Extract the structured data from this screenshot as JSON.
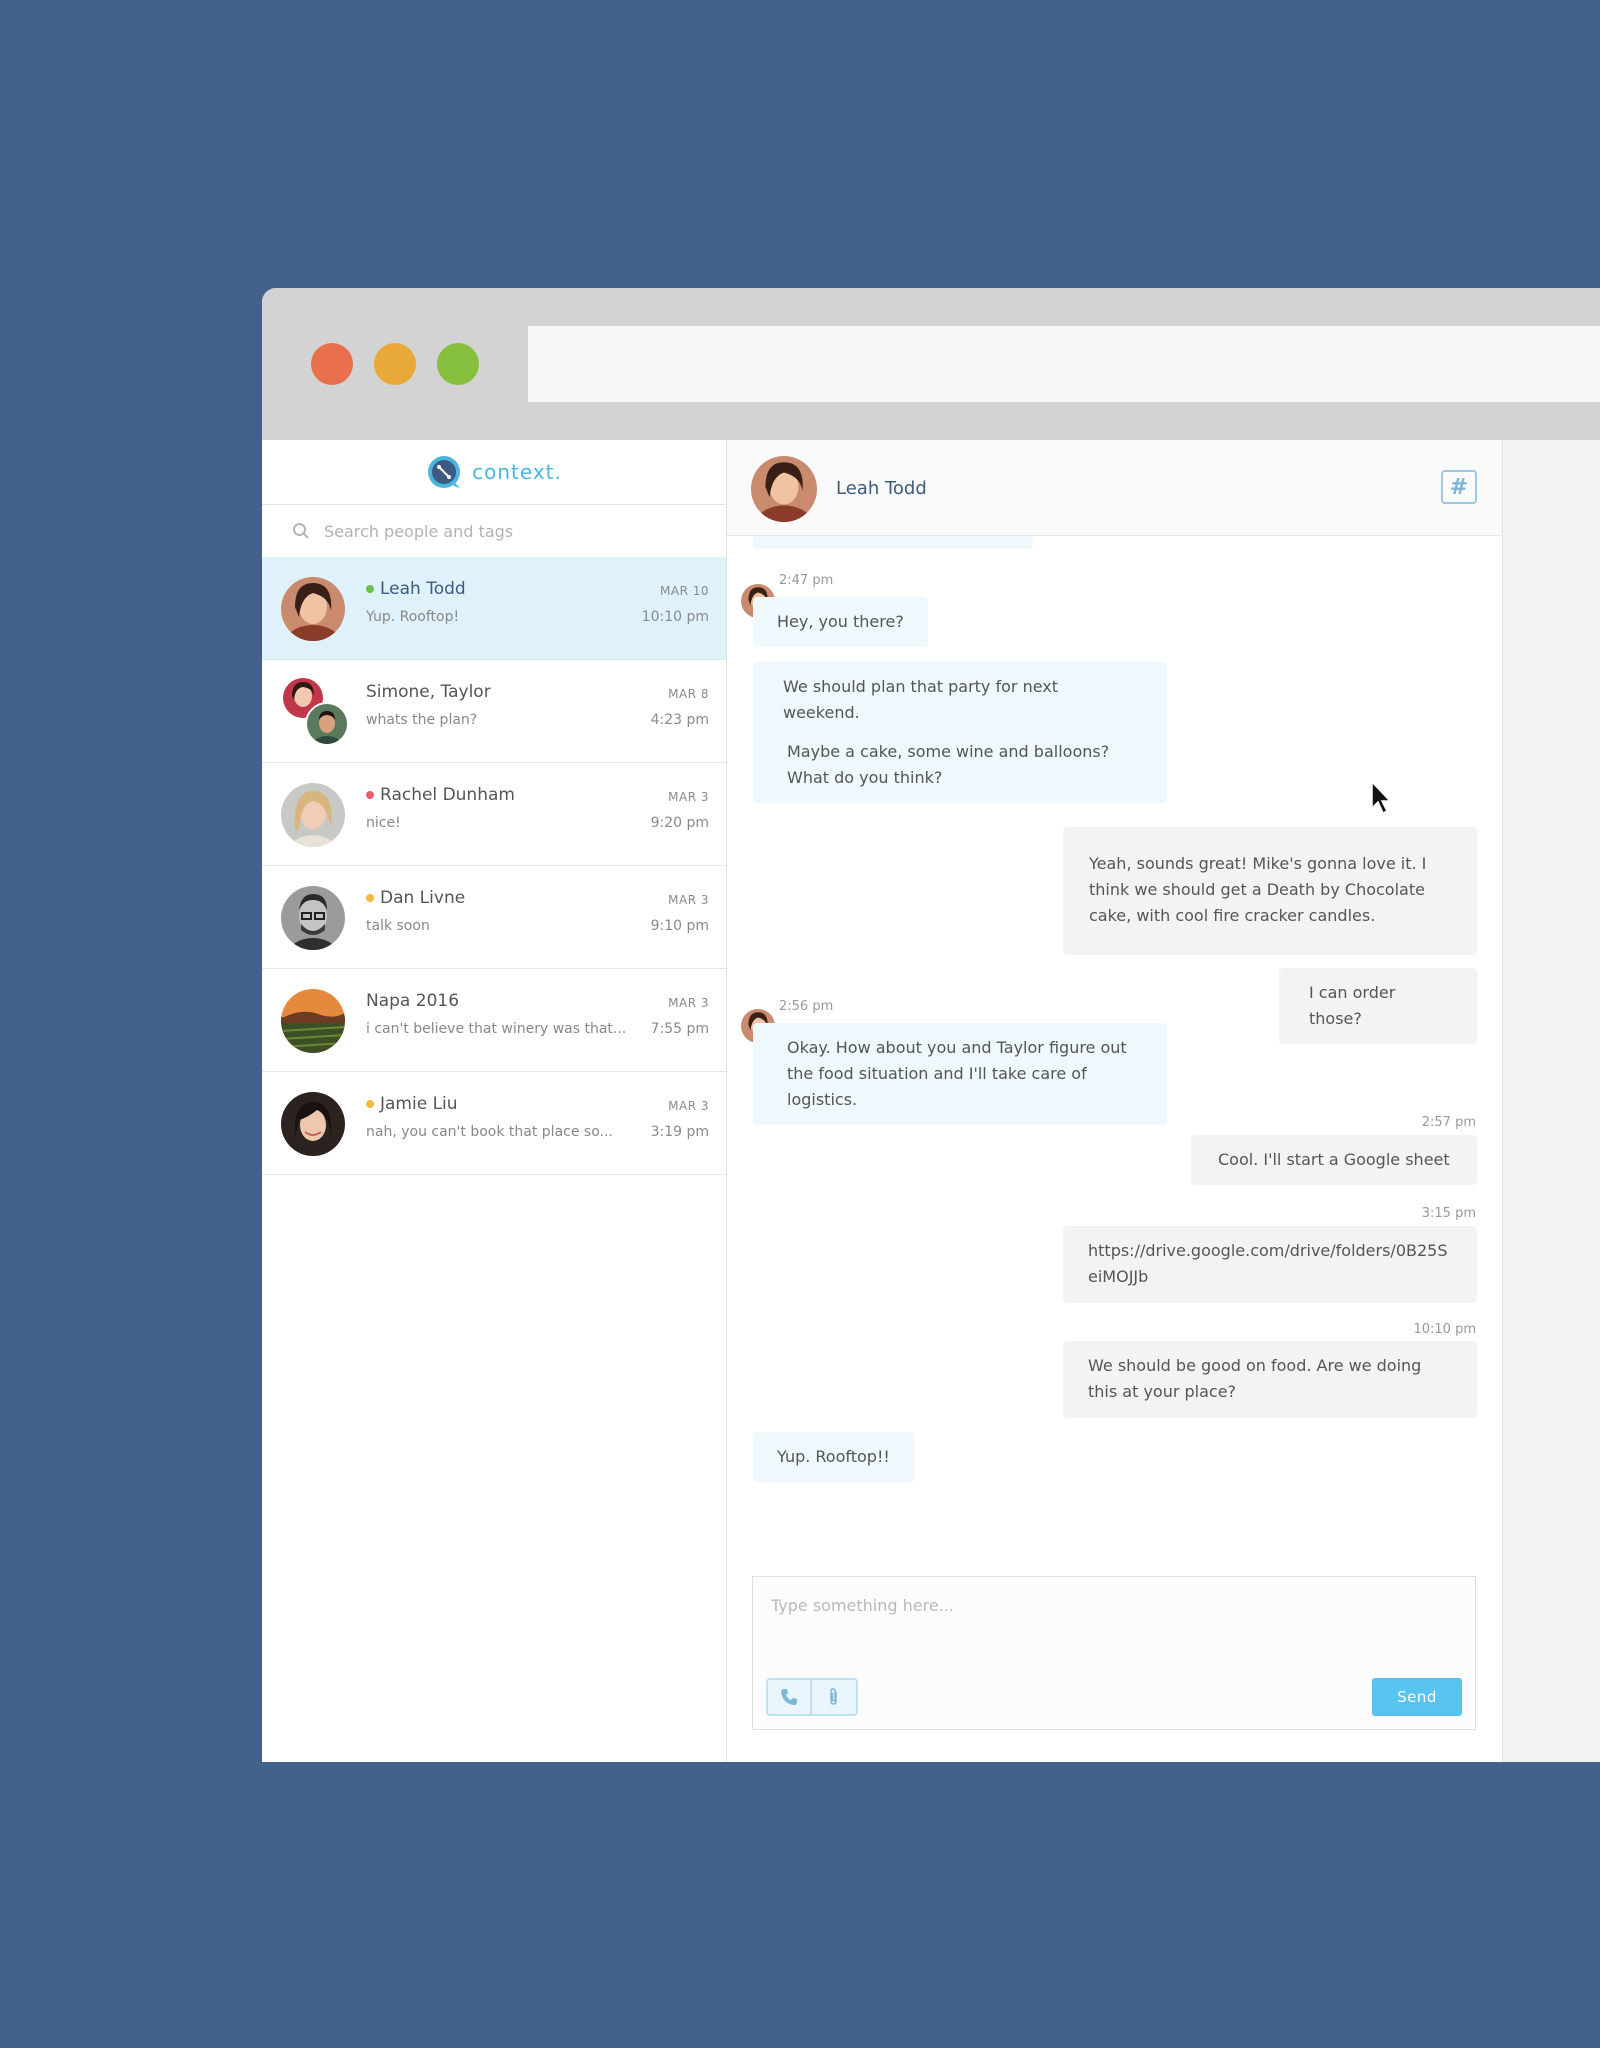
{
  "app": {
    "logo_text": "context."
  },
  "search": {
    "placeholder": "Search people and tags"
  },
  "conversations": [
    {
      "name": "Leah Todd",
      "preview": "Yup. Rooftop!",
      "date": "MAR 10",
      "time": "10:10 pm",
      "status_color": "#6cc04a"
    },
    {
      "name": "Simone, Taylor",
      "preview": "whats the plan?",
      "date": "MAR 8",
      "time": "4:23 pm"
    },
    {
      "name": "Rachel Dunham",
      "preview": "nice!",
      "date": "MAR 3",
      "time": "9:20 pm",
      "status_color": "#ef5b6a"
    },
    {
      "name": "Dan Livne",
      "preview": "talk soon",
      "date": "MAR 3",
      "time": "9:10 pm",
      "status_color": "#f3b93d"
    },
    {
      "name": "Napa 2016",
      "preview": "i can't believe that winery was that...",
      "date": "MAR 3",
      "time": "7:55 pm"
    },
    {
      "name": "Jamie Liu",
      "preview": "nah, you can't book that place so...",
      "date": "MAR 3",
      "time": "3:19 pm",
      "status_color": "#f3b93d"
    }
  ],
  "chat": {
    "contact_name": "Leah Todd",
    "tag_icon": "hash-icon",
    "tag_symbol": "#",
    "messages": [
      {
        "direction": "in",
        "timestamp": "2:47 pm",
        "text": "Hey, you there?"
      },
      {
        "direction": "in",
        "text": "We should plan that party for next weekend."
      },
      {
        "direction": "in",
        "text": "Maybe a cake, some wine and balloons? What do you think?"
      },
      {
        "direction": "out",
        "text": "Yeah, sounds great! Mike's gonna love it. I think we should get a Death by Chocolate cake, with cool fire cracker candles."
      },
      {
        "direction": "out",
        "text": "I can order those?"
      },
      {
        "direction": "in",
        "timestamp": "2:56 pm",
        "text": "Okay. How about you and Taylor figure out the food situation and I'll take care of logistics."
      },
      {
        "direction": "out",
        "timestamp": "2:57 pm",
        "text": "Cool. I'll start a Google sheet"
      },
      {
        "direction": "out",
        "timestamp": "3:15 pm",
        "text": "https://drive.google.com/drive/folders/0B25SeiMOJJb"
      },
      {
        "direction": "out",
        "timestamp": "10:10 pm",
        "text": "We should be good on food. Are we doing this at your place?"
      },
      {
        "direction": "in",
        "text": "Yup. Rooftop!!"
      }
    ]
  },
  "composer": {
    "placeholder": "Type something here...",
    "send_label": "Send",
    "call_icon": "phone-icon",
    "attach_icon": "paperclip-icon"
  },
  "colors": {
    "background": "#44618b",
    "accent": "#56c4ef",
    "active_row": "#dff2fb",
    "traffic_red": "#e9704d",
    "traffic_yellow": "#e8a93a",
    "traffic_green": "#86c03e"
  }
}
